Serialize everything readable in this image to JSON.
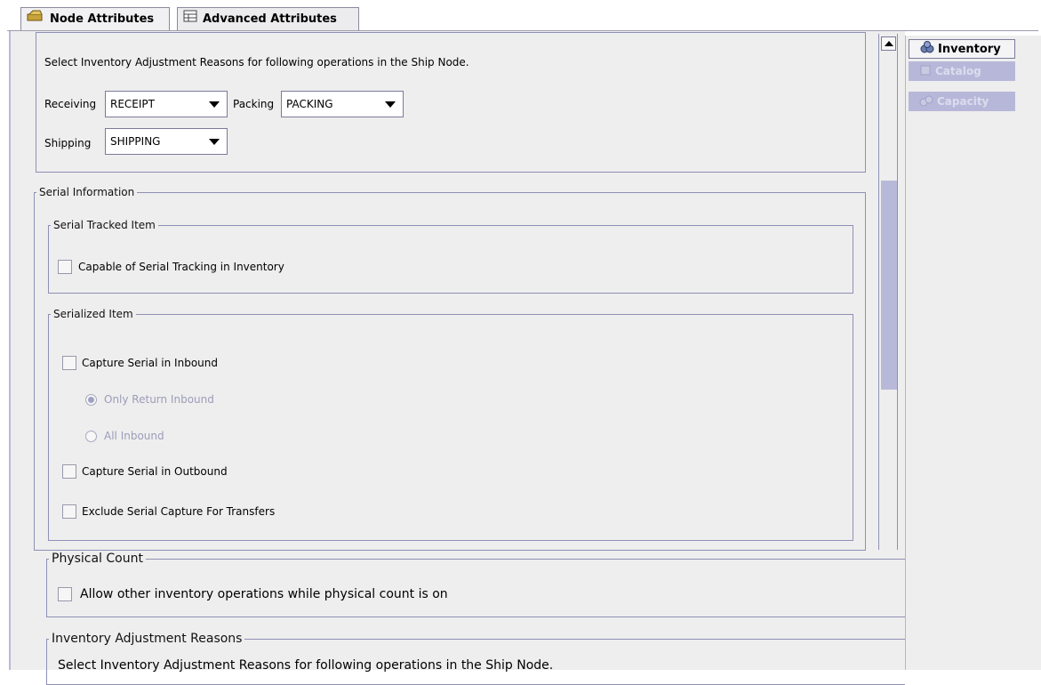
{
  "tabs": [
    {
      "label": "Node Attributes",
      "icon": "node-icon"
    },
    {
      "label": "Advanced Attributes",
      "icon": "table-icon"
    }
  ],
  "top_section": {
    "instruction": "Select Inventory Adjustment Reasons for following operations in the Ship Node.",
    "receiving": {
      "label": "Receiving",
      "value": "RECEIPT"
    },
    "packing": {
      "label": "Packing",
      "value": "PACKING"
    },
    "shipping": {
      "label": "Shipping",
      "value": "SHIPPING"
    }
  },
  "serial_information": {
    "legend": "Serial Information",
    "serial_tracked": {
      "legend": "Serial Tracked Item",
      "capable_label": "Capable of Serial Tracking in Inventory"
    },
    "serialized": {
      "legend": "Serialized Item",
      "capture_inbound": "Capture Serial in Inbound",
      "only_return_inbound": "Only Return Inbound",
      "all_inbound": "All Inbound",
      "capture_outbound": "Capture Serial in Outbound",
      "exclude_transfers": "Exclude Serial Capture For Transfers"
    }
  },
  "physical_count": {
    "legend": "Physical Count",
    "allow_label": "Allow other inventory operations while physical count is on"
  },
  "adjustment_reasons": {
    "legend": "Inventory Adjustment Reasons",
    "instruction": "Select Inventory Adjustment Reasons for following operations in the Ship Node."
  },
  "side_tabs": [
    {
      "label": "Inventory",
      "icon": "inventory-icon",
      "state": "active"
    },
    {
      "label": "Catalog",
      "icon": "catalog-icon",
      "state": "disabled"
    },
    {
      "label": "Capacity",
      "icon": "capacity-icon",
      "state": "disabled"
    }
  ],
  "colors": {
    "panel_bg": "#eeeeee",
    "group_border": "#8f90b5",
    "scroll_thumb": "#b8b9d9",
    "disabled_tab_bg": "#b7b8d9",
    "disabled_text": "#9c9cba"
  }
}
